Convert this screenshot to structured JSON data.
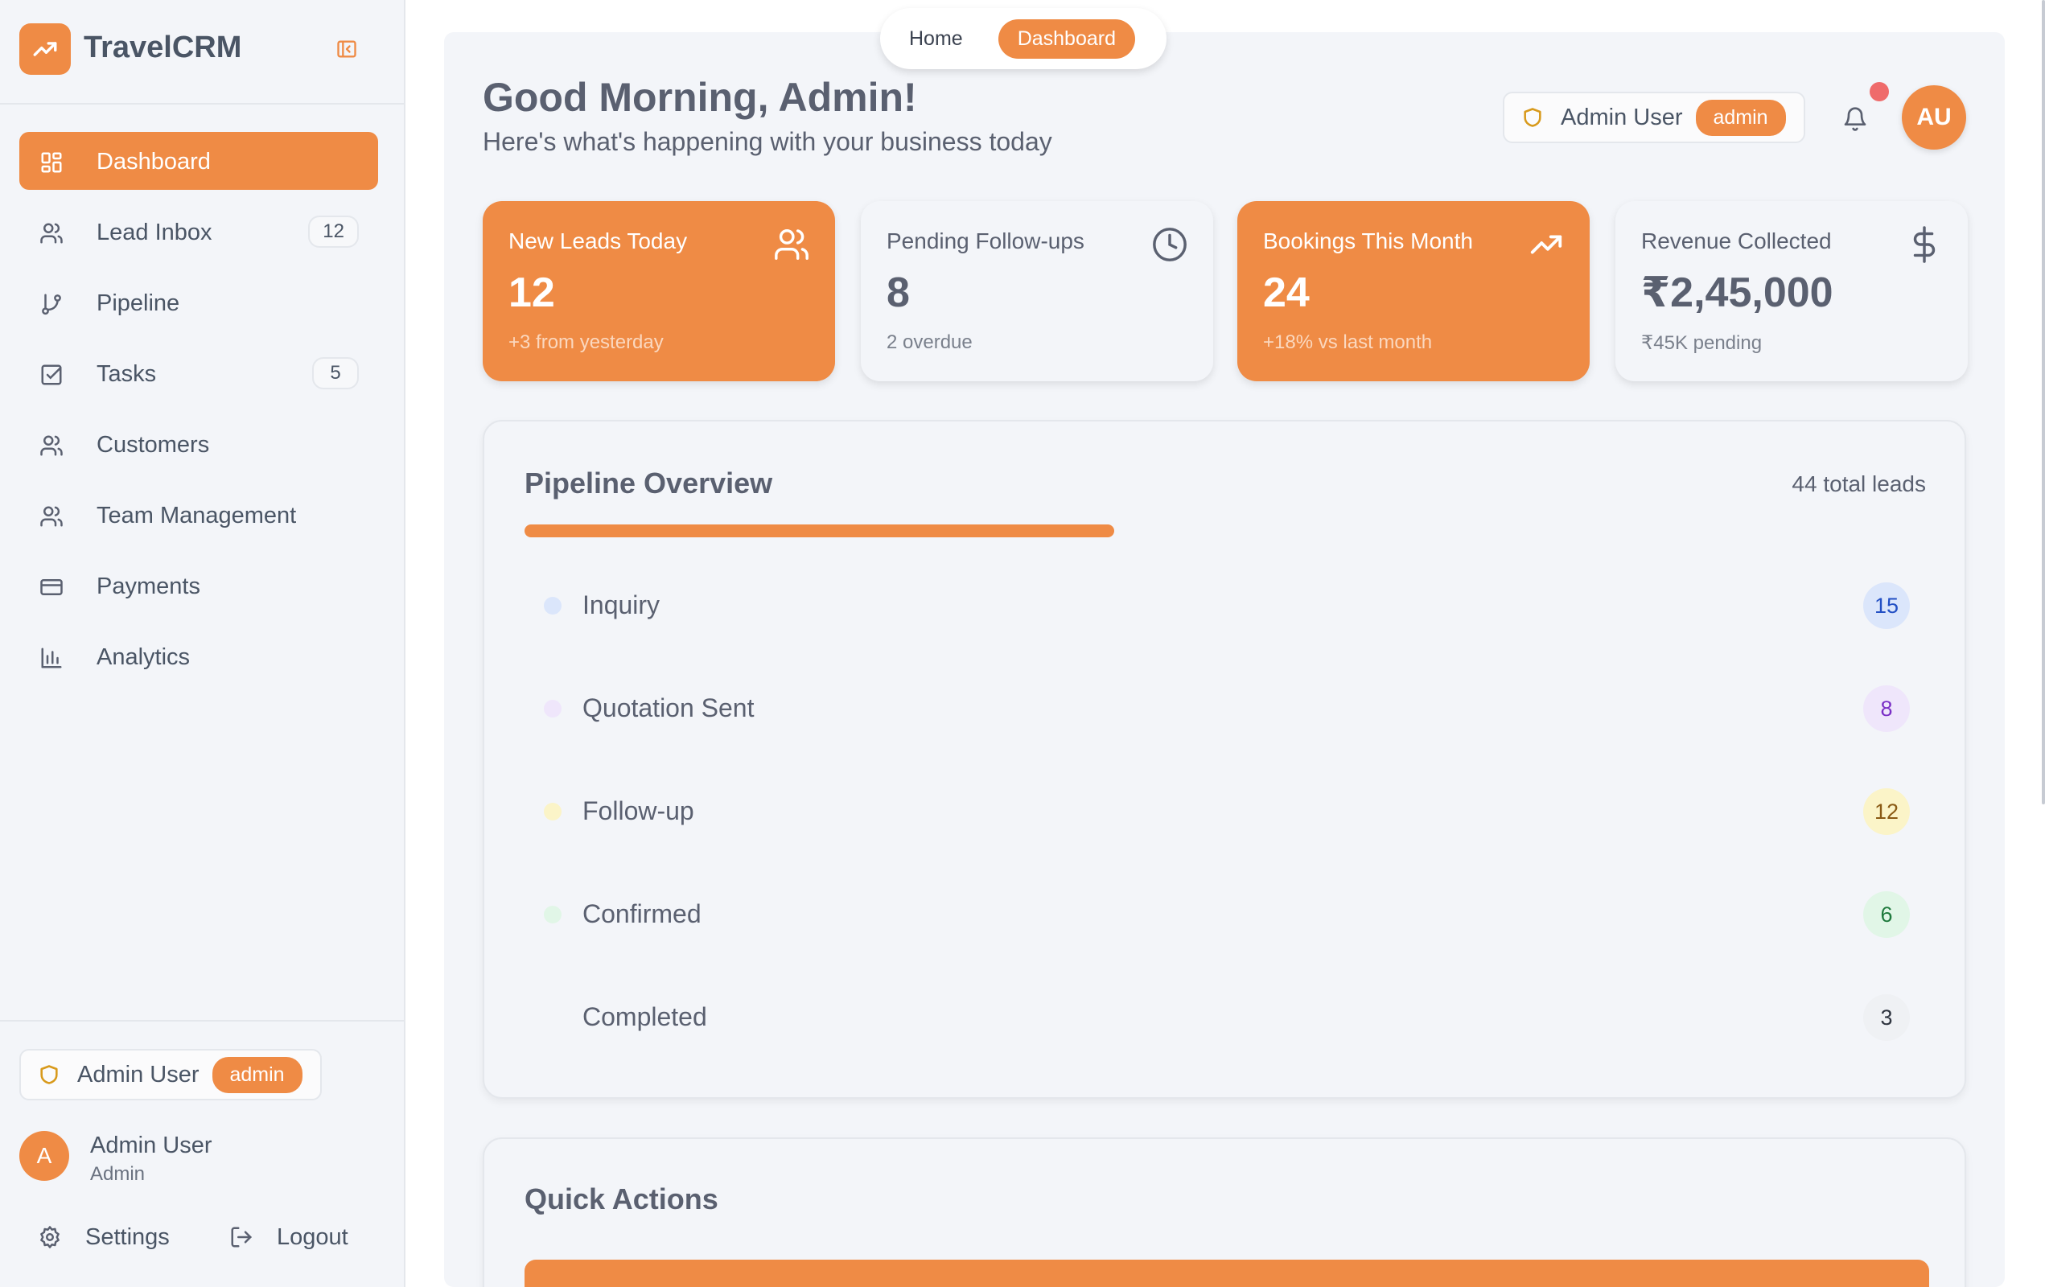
{
  "app": {
    "name": "TravelCRM"
  },
  "nav": [
    {
      "label": "Dashboard",
      "icon": "dashboard-icon",
      "active": true
    },
    {
      "label": "Lead Inbox",
      "icon": "users-icon",
      "badge": "12"
    },
    {
      "label": "Pipeline",
      "icon": "git-branch-icon"
    },
    {
      "label": "Tasks",
      "icon": "checkbox-icon",
      "badge": "5"
    },
    {
      "label": "Customers",
      "icon": "users-icon"
    },
    {
      "label": "Team Management",
      "icon": "users-icon"
    },
    {
      "label": "Payments",
      "icon": "credit-card-icon"
    },
    {
      "label": "Analytics",
      "icon": "bar-chart-icon"
    }
  ],
  "sidebar_footer": {
    "role_name": "Admin User",
    "role_badge": "admin",
    "user_initial": "A",
    "user_name": "Admin User",
    "user_role": "Admin",
    "settings_label": "Settings",
    "logout_label": "Logout"
  },
  "breadcrumb": {
    "home": "Home",
    "current": "Dashboard"
  },
  "header": {
    "greeting": "Good Morning, Admin!",
    "subtitle": "Here's what's happening with your business today",
    "role_name": "Admin User",
    "role_badge": "admin",
    "avatar_initials": "AU"
  },
  "stats": [
    {
      "title": "New Leads Today",
      "value": "12",
      "note": "+3 from yesterday",
      "icon": "users-icon",
      "style": "orange"
    },
    {
      "title": "Pending Follow-ups",
      "value": "8",
      "note": "2 overdue",
      "icon": "clock-icon",
      "style": "light"
    },
    {
      "title": "Bookings This Month",
      "value": "24",
      "note": "+18% vs last month",
      "icon": "trending-up-icon",
      "style": "orange"
    },
    {
      "title": "Revenue Collected",
      "value": "₹2,45,000",
      "note": "₹45K pending",
      "icon": "dollar-icon",
      "style": "light"
    }
  ],
  "pipeline": {
    "title": "Pipeline Overview",
    "total_label": "44 total leads",
    "progress_fraction": 0.42,
    "stages": [
      {
        "label": "Inquiry",
        "count": "15",
        "dot": "#dbe6fb",
        "badge_bg": "#dbe6fb",
        "badge_fg": "#2350c4"
      },
      {
        "label": "Quotation Sent",
        "count": "8",
        "dot": "#efe6fb",
        "badge_bg": "#efe6fb",
        "badge_fg": "#7a2fc6"
      },
      {
        "label": "Follow-up",
        "count": "12",
        "dot": "#fbf4c8",
        "badge_bg": "#fbf4c8",
        "badge_fg": "#8a5a14"
      },
      {
        "label": "Confirmed",
        "count": "6",
        "dot": "#e1f6e7",
        "badge_bg": "#e1f6e7",
        "badge_fg": "#1f7a3d"
      },
      {
        "label": "Completed",
        "count": "3",
        "dot": "#f3f5f9",
        "badge_bg": "#eff1f4",
        "badge_fg": "#2f3540"
      }
    ]
  },
  "quick_actions": {
    "title": "Quick Actions"
  },
  "colors": {
    "accent": "#ef8b45",
    "notification": "#ef6b6b"
  }
}
